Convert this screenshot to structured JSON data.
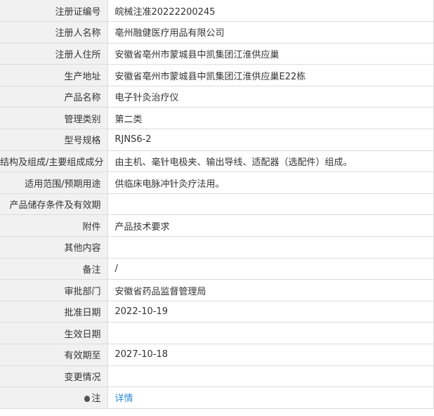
{
  "record": {
    "rows": [
      {
        "label": "注册证编号",
        "value": "皖械注准20222200245"
      },
      {
        "label": "注册人名称",
        "value": "亳州融健医疗用品有限公司"
      },
      {
        "label": "注册人住所",
        "value": "安徽省亳州市蒙城县中凯集团江淮供应巢"
      },
      {
        "label": "生产地址",
        "value": "安徽省亳州市蒙城县中凯集团江淮供应巢E22栋"
      },
      {
        "label": "产品名称",
        "value": "电子针灸治疗仪"
      },
      {
        "label": "管理类别",
        "value": "第二类"
      },
      {
        "label": "型号规格",
        "value": "RJNS6-2"
      },
      {
        "label": "结构及组成/主要组成成分",
        "value": "由主机、毫针电极夹、输出导线、适配器（选配件）组成。"
      },
      {
        "label": "适用范围/预期用途",
        "value": "供临床电脉冲针灸疗法用。"
      },
      {
        "label": "产品储存条件及有效期",
        "value": ""
      },
      {
        "label": "附件",
        "value": "产品技术要求"
      },
      {
        "label": "其他内容",
        "value": ""
      },
      {
        "label": "备注",
        "value": "/"
      },
      {
        "label": "审批部门",
        "value": "安徽省药品监督管理局"
      },
      {
        "label": "批准日期",
        "value": "2022-10-19"
      },
      {
        "label": "生效日期",
        "value": ""
      },
      {
        "label": "有效期至",
        "value": "2027-10-18"
      },
      {
        "label": "变更情况",
        "value": ""
      }
    ],
    "note": {
      "label": "注",
      "link_text": "详情",
      "icon": "pin-icon"
    }
  },
  "colors": {
    "label_background": "#f1f1f1",
    "border": "#dcdcdc",
    "link": "#2a8ad4",
    "text": "#333333"
  }
}
